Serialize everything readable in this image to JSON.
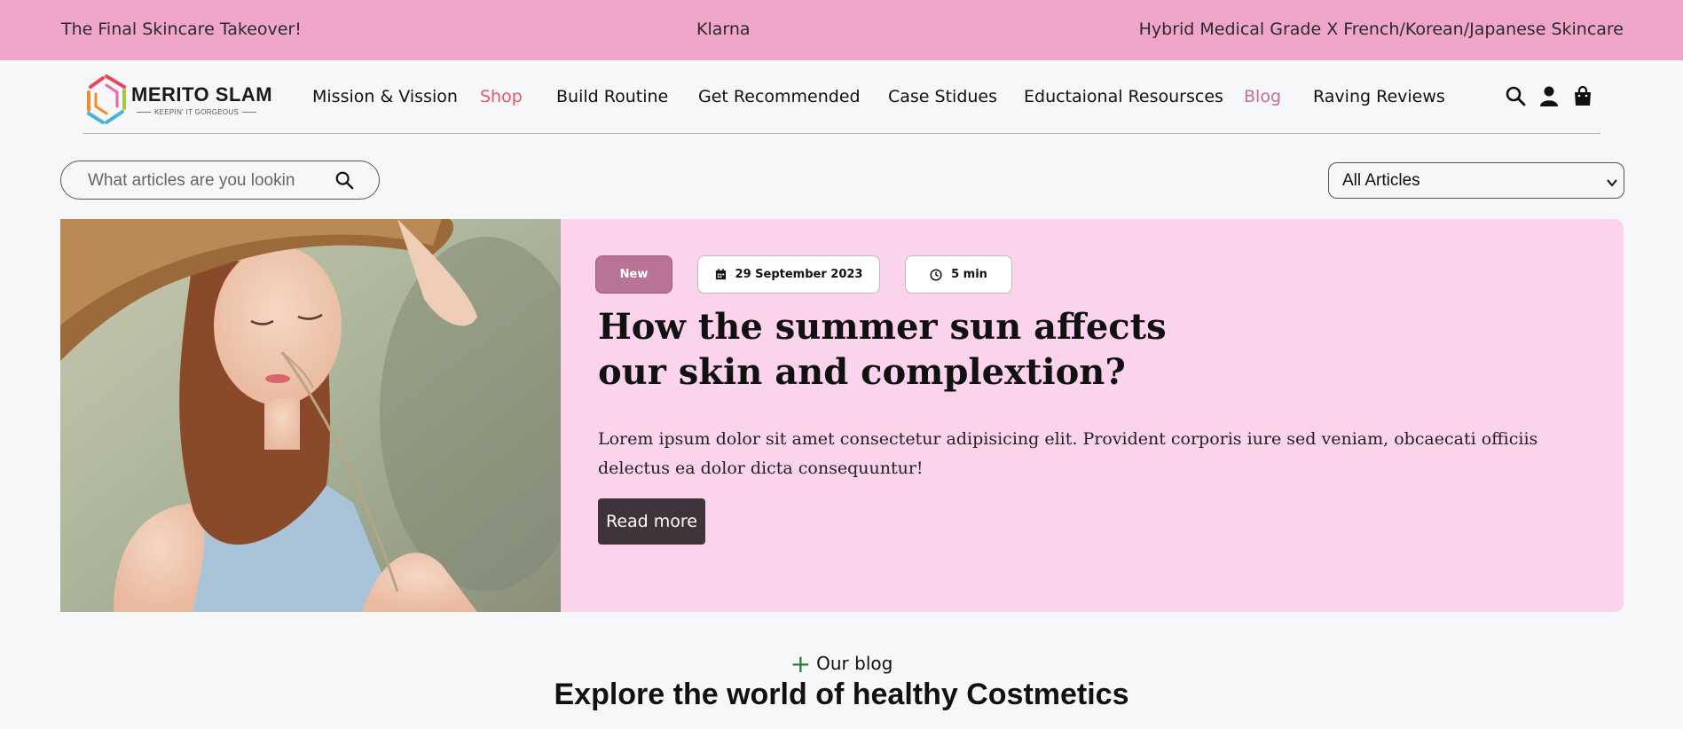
{
  "announcement": {
    "left": "The Final Skincare Takeover!",
    "middle": "Klarna",
    "right": "Hybrid Medical Grade X French/Korean/Japanese Skincare"
  },
  "brand": {
    "name": "MERITO SLAM",
    "tagline": "KEEPIN' IT GORGEOUS"
  },
  "nav": {
    "items": [
      {
        "label": "Mission & Vission"
      },
      {
        "label": "Shop",
        "active": true,
        "color": "#e8556f"
      },
      {
        "label": "Build Routine"
      },
      {
        "label": "Get Recommended"
      },
      {
        "label": "Case Stidues"
      },
      {
        "label": "Eductaional Resoursces"
      },
      {
        "label": "Blog",
        "active": true,
        "color": "#c16e98"
      },
      {
        "label": "Raving Reviews"
      }
    ],
    "icons": [
      "search-icon",
      "user-icon",
      "shopping-bag-icon"
    ]
  },
  "search": {
    "placeholder": "What articles are you lookin"
  },
  "filter": {
    "selected": "All Articles"
  },
  "featured": {
    "badge": "New",
    "date": "29 September 2023",
    "read_time": "5 min",
    "title_line1": "How the summer sun affects",
    "title_line2": "our skin and complextion?",
    "excerpt": "Lorem ipsum dolor sit amet consectetur adipisicing elit. Provident corporis iure sed veniam, obcaecati officiis delectus ea dolor dicta consequuntur!",
    "cta": "Read more"
  },
  "section": {
    "eyebrow": "Our blog",
    "title": "Explore the world of healthy Costmetics"
  },
  "colors": {
    "topbar": "#f0a6cb",
    "card": "#fcd3ec",
    "badge_new": "#b97399",
    "button": "#3e343a"
  }
}
